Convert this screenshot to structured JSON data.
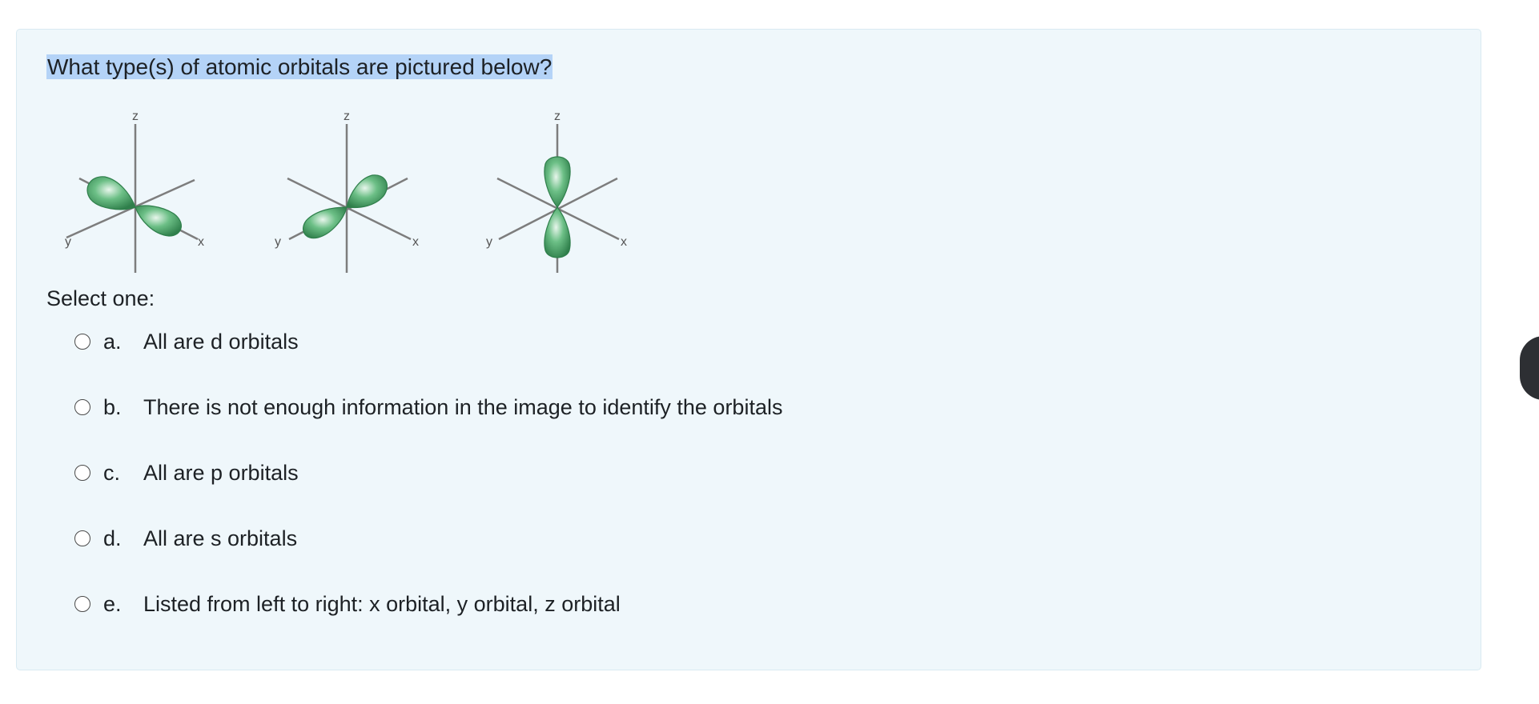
{
  "question": {
    "text": "What type(s) of atomic orbitals are pictured below?"
  },
  "figure": {
    "axis_labels": {
      "z": "z",
      "y": "y",
      "x": "x"
    },
    "orbital_color": "#3c9a5c"
  },
  "answer_block": {
    "prompt": "Select one:",
    "options": [
      {
        "letter": "a.",
        "label": "All are d orbitals"
      },
      {
        "letter": "b.",
        "label": "There is not enough information in the image to identify the orbitals"
      },
      {
        "letter": "c.",
        "label": "All are p orbitals"
      },
      {
        "letter": "d.",
        "label": "All are s orbitals"
      },
      {
        "letter": "e.",
        "label": "Listed from left to right: x orbital, y orbital, z orbital"
      }
    ]
  }
}
